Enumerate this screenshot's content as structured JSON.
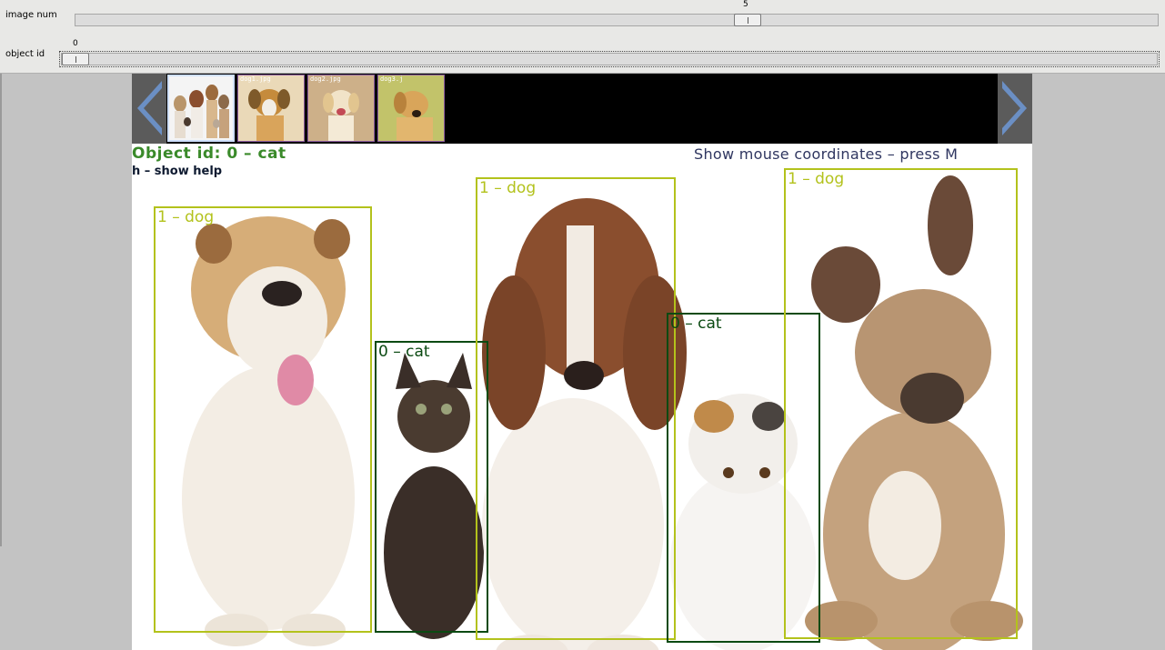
{
  "trackbars": [
    {
      "label": "image num",
      "value": "5"
    },
    {
      "label": "object id",
      "value": "0"
    }
  ],
  "thumbnails": [
    {
      "name": "",
      "selected": true
    },
    {
      "name": "dog1.jpg",
      "selected": false
    },
    {
      "name": "dog2.jpg",
      "selected": false
    },
    {
      "name": "dog3.j",
      "selected": false
    }
  ],
  "overlay": {
    "object_info": "Object id: 0   – cat",
    "help_hint": "h – show help",
    "mouse_hint": "Show mouse coordinates – press M"
  },
  "boxes": [
    {
      "label": "1 – dog",
      "class": "dog"
    },
    {
      "label": "0 – cat",
      "class": "cat"
    },
    {
      "label": "1 – dog",
      "class": "dog"
    },
    {
      "label": "0 – cat",
      "class": "cat"
    },
    {
      "label": "1 – dog",
      "class": "dog"
    }
  ],
  "colors": {
    "dog_box": "#b3c21c",
    "cat_box": "#0b4a12",
    "object_text": "#3a8a2a",
    "nav_arrow": "#6b8fc4"
  }
}
